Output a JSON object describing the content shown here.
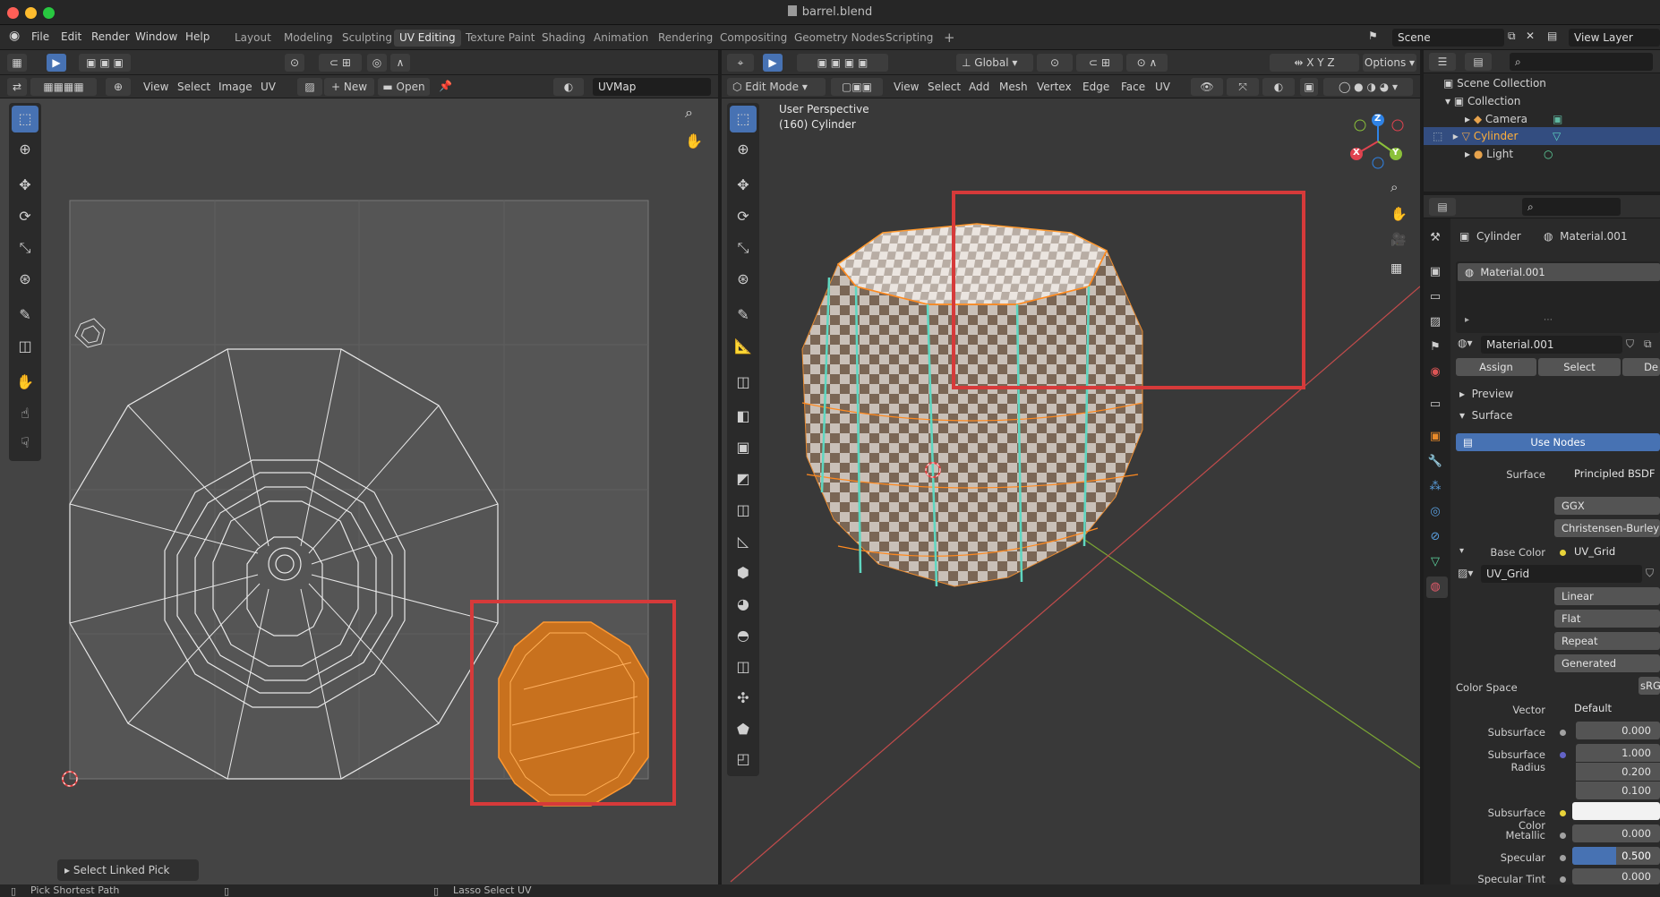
{
  "window": {
    "title": "barrel.blend"
  },
  "menubar": {
    "items": [
      "File",
      "Edit",
      "Render",
      "Window",
      "Help"
    ]
  },
  "workspace_tabs": [
    "Layout",
    "Modeling",
    "Sculpting",
    "UV Editing",
    "Texture Paint",
    "Shading",
    "Animation",
    "Rendering",
    "Compositing",
    "Geometry Nodes",
    "Scripting"
  ],
  "workspace_active": "UV Editing",
  "scene": {
    "name": "Scene",
    "view_layer": "View Layer"
  },
  "uv_editor": {
    "menus": [
      "View",
      "Select",
      "Image",
      "UV"
    ],
    "new_label": "New",
    "open_label": "Open",
    "uvmap": "UVMap",
    "operator_panel": "Select Linked Pick"
  },
  "viewport": {
    "global": "Global",
    "options": "Options",
    "mode": "Edit Mode",
    "menus": [
      "View",
      "Select",
      "Add",
      "Mesh",
      "Vertex",
      "Edge",
      "Face",
      "UV"
    ],
    "overlay_line1": "User Perspective",
    "overlay_line2": "(160) Cylinder",
    "axes": {
      "x": "X",
      "y": "Y",
      "z": "Z"
    },
    "colors": {
      "x": "#e0434f",
      "y": "#8bc03a",
      "z": "#2f83e6"
    }
  },
  "outliner": {
    "scene_collection": "Scene Collection",
    "collection": "Collection",
    "items": [
      "Camera",
      "Cylinder",
      "Light"
    ]
  },
  "properties": {
    "object": "Cylinder",
    "material_tab": "Material.001",
    "slot": "Material.001",
    "material_name": "Material.001",
    "assign": "Assign",
    "select": "Select",
    "deselect": "De",
    "preview": "Preview",
    "surface_section": "Surface",
    "use_nodes": "Use Nodes",
    "rows": {
      "surface_label": "Surface",
      "surface_value": "Principled BSDF",
      "ggx": "GGX",
      "christensen": "Christensen-Burley",
      "base_color_label": "Base Color",
      "base_color_value": "UV_Grid",
      "image_name": "UV_Grid",
      "linear": "Linear",
      "flat": "Flat",
      "repeat": "Repeat",
      "generated": "Generated",
      "color_space_label": "Color Space",
      "color_space_value": "sRGB",
      "vector_label": "Vector",
      "vector_value": "Default",
      "subsurface_label": "Subsurface",
      "subsurface_value": "0.000",
      "subsurface_radius_label": "Subsurface Radius",
      "subsurface_radius": [
        "1.000",
        "0.200",
        "0.100"
      ],
      "subsurface_color_label": "Subsurface Color",
      "metallic_label": "Metallic",
      "metallic_value": "0.000",
      "specular_label": "Specular",
      "specular_value": "0.500",
      "specular_tint_label": "Specular Tint",
      "specular_tint_value": "0.000"
    }
  },
  "statusbar": {
    "left": "Pick Shortest Path",
    "middle": "Lasso Select UV"
  },
  "colors": {
    "accent": "#4772b3",
    "highlight": "#d63a3a",
    "selection": "#e87d20",
    "seam": "#5fd6c0"
  }
}
